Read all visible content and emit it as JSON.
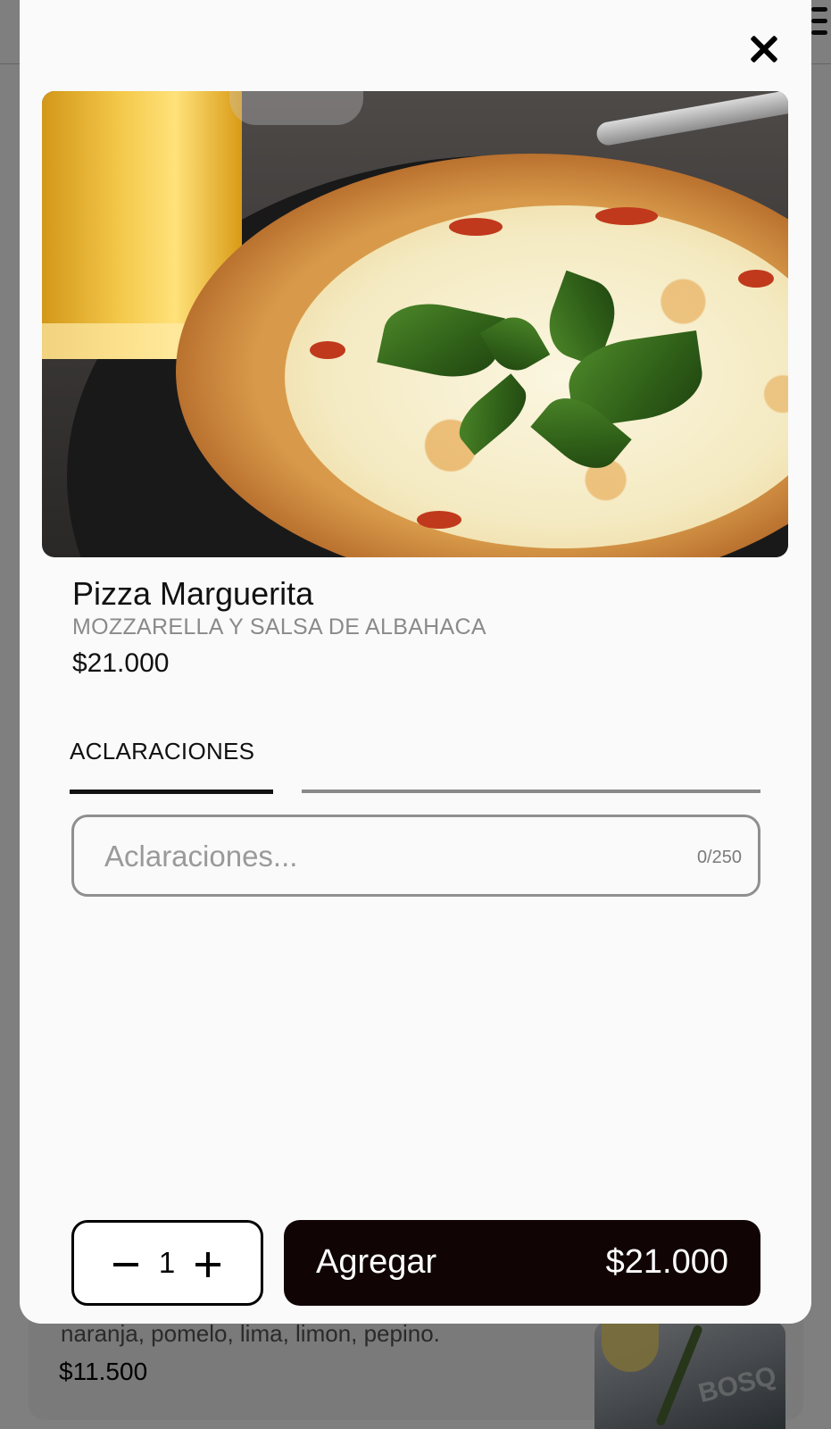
{
  "background": {
    "card": {
      "description": "naranja, pomelo, lima, limon, pepino.",
      "price": "$11.500",
      "image_text": "BOSQ"
    }
  },
  "modal": {
    "product": {
      "name": "Pizza Marguerita",
      "description": "MOZZARELLA Y SALSA DE ALBAHACA",
      "price": "$21.000"
    },
    "tabs": [
      {
        "label": "ACLARACIONES",
        "active": true
      }
    ],
    "notes": {
      "placeholder": "Aclaraciones...",
      "value": "",
      "counter": "0/250"
    },
    "quantity": {
      "value": "1"
    },
    "add_button": {
      "label": "Agregar",
      "price": "$21.000"
    }
  },
  "icons": {
    "close": "close-icon",
    "menu": "hamburger-menu-icon",
    "minus": "minus-icon",
    "plus": "plus-icon"
  },
  "colors": {
    "modal_background": "#fafafa",
    "button_dark": "#100404",
    "muted_text": "#8a8a8a"
  }
}
